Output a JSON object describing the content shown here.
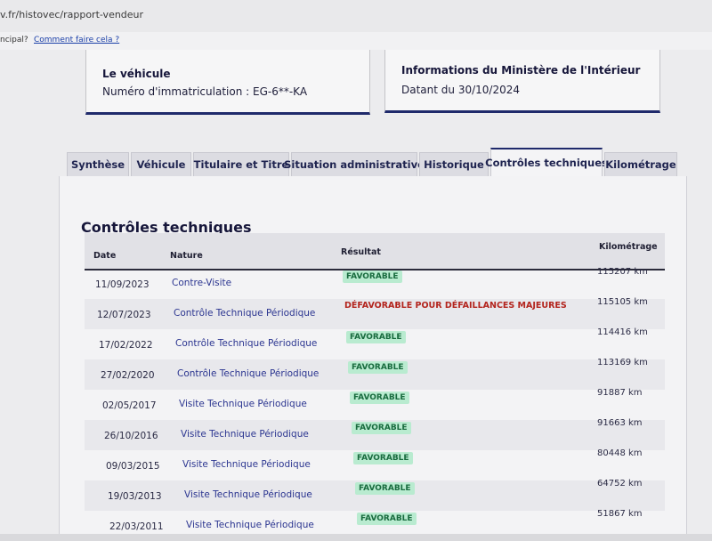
{
  "browser": {
    "url": "v.fr/histovec/rapport-vendeur",
    "notif_question": "ncipal?",
    "notif_link": "Comment faire cela ?"
  },
  "vehicle_card": {
    "title": "Le véhicule",
    "registration": "Numéro d'immatriculation : EG-6**-KA"
  },
  "ministry_card": {
    "title": "Informations du Ministère de l'Intérieur",
    "date": "Datant du 30/10/2024"
  },
  "tabs": [
    {
      "label": "Synthèse",
      "active": false
    },
    {
      "label": "Véhicule",
      "active": false
    },
    {
      "label": "Titulaire et Titre",
      "active": false
    },
    {
      "label": "Situation administrative",
      "active": false
    },
    {
      "label": "Historique",
      "active": false
    },
    {
      "label": "Contrôles techniques",
      "active": true
    },
    {
      "label": "Kilométrage",
      "active": false
    }
  ],
  "section": {
    "title": "Contrôles techniques",
    "headers": {
      "date": "Date",
      "nature": "Nature",
      "result": "Résultat",
      "mileage": "Kilométrage"
    },
    "rows": [
      {
        "date": "11/09/2023",
        "nature": "Contre-Visite",
        "result": "FAVORABLE",
        "status": "ok",
        "km": "115207 km"
      },
      {
        "date": "12/07/2023",
        "nature": "Contrôle Technique Périodique",
        "result": "DÉFAVORABLE POUR DÉFAILLANCES MAJEURES",
        "status": "ko",
        "km": "115105 km"
      },
      {
        "date": "17/02/2022",
        "nature": "Contrôle Technique Périodique",
        "result": "FAVORABLE",
        "status": "ok",
        "km": "114416 km"
      },
      {
        "date": "27/02/2020",
        "nature": "Contrôle Technique Périodique",
        "result": "FAVORABLE",
        "status": "ok",
        "km": "113169 km"
      },
      {
        "date": "02/05/2017",
        "nature": "Visite Technique Périodique",
        "result": "FAVORABLE",
        "status": "ok",
        "km": "91887 km"
      },
      {
        "date": "26/10/2016",
        "nature": "Visite Technique Périodique",
        "result": "FAVORABLE",
        "status": "ok",
        "km": "91663 km"
      },
      {
        "date": "09/03/2015",
        "nature": "Visite Technique Périodique",
        "result": "FAVORABLE",
        "status": "ok",
        "km": "80448 km"
      },
      {
        "date": "19/03/2013",
        "nature": "Visite Technique Périodique",
        "result": "FAVORABLE",
        "status": "ok",
        "km": "64752 km"
      },
      {
        "date": "22/03/2011",
        "nature": "Visite Technique Périodique",
        "result": "FAVORABLE",
        "status": "ok",
        "km": "51867 km"
      }
    ]
  },
  "colors": {
    "accent": "#1f2a6b",
    "favorable_bg": "#b9ebd0",
    "favorable_text": "#186b3e",
    "defavorable_text": "#b3241d",
    "link": "#2b3590"
  }
}
